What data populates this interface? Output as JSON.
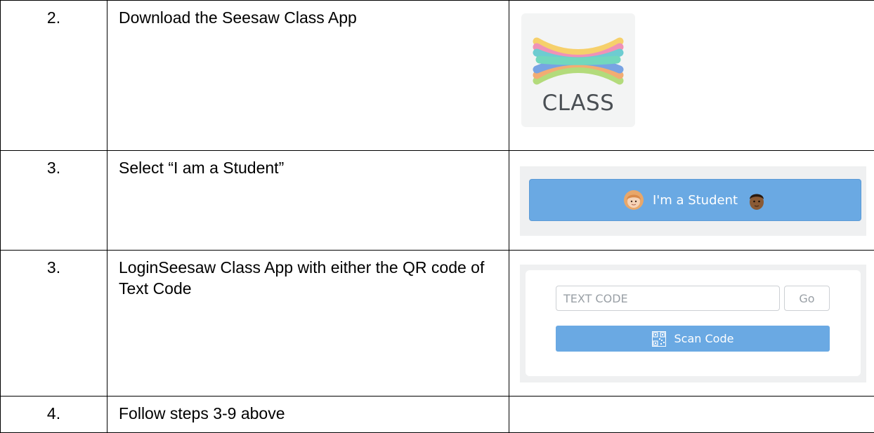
{
  "rows": [
    {
      "number": "2.",
      "instruction": "Download the Seesaw Class App",
      "visual": {
        "type": "app-icon",
        "icon_text": "CLASS"
      }
    },
    {
      "number": "3.",
      "instruction": "Select “I am a Student”",
      "visual": {
        "type": "button",
        "button_label": "I'm a Student",
        "button_color": "#6aa9e3"
      }
    },
    {
      "number": "3.",
      "instruction": "LoginSeesaw Class App with either the QR code of Text Code",
      "visual": {
        "type": "login-form",
        "input_placeholder": "TEXT CODE",
        "go_label": "Go",
        "scan_label": "Scan Code",
        "button_color": "#6aa9e3"
      }
    },
    {
      "number": "4.",
      "instruction": "Follow steps 3-9 above"
    }
  ]
}
